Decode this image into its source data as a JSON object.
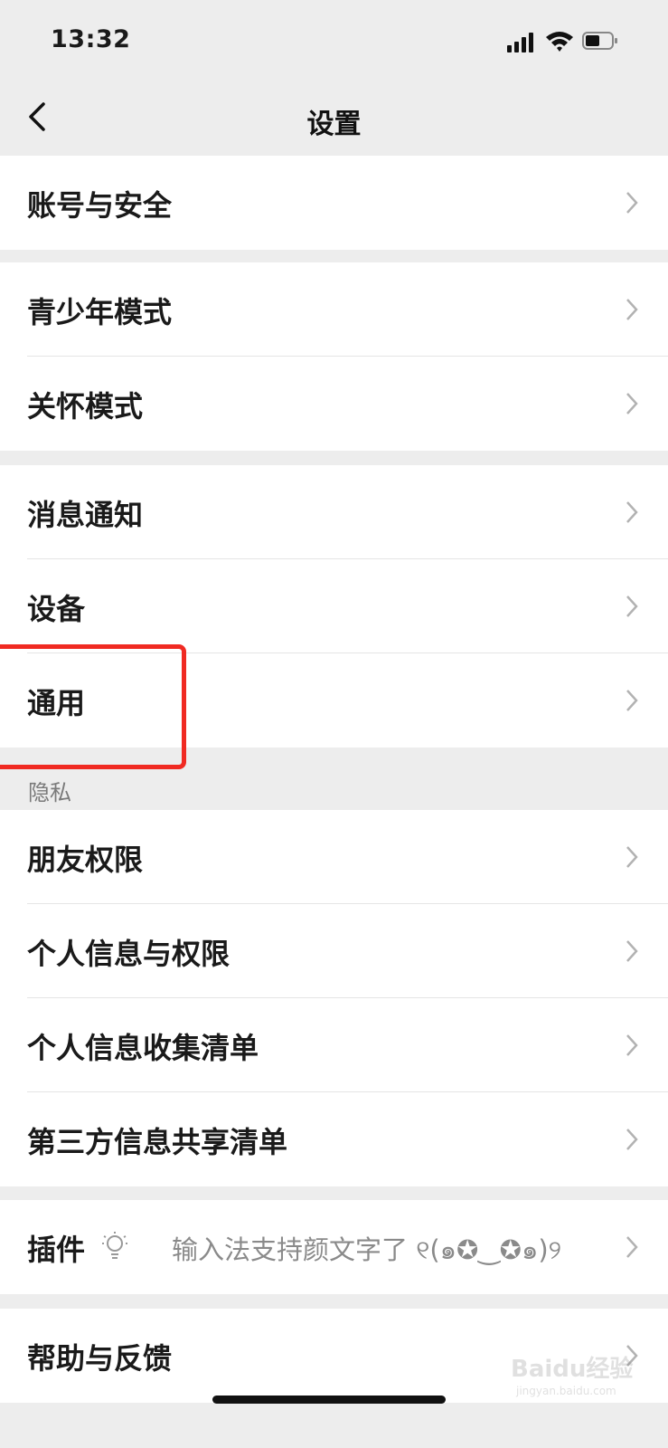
{
  "status": {
    "time": "13:32"
  },
  "nav": {
    "title": "设置"
  },
  "groups": {
    "account": {
      "items": [
        "账号与安全"
      ]
    },
    "mode": {
      "items": [
        "青少年模式",
        "关怀模式"
      ]
    },
    "general": {
      "items": [
        "消息通知",
        "设备",
        "通用"
      ]
    },
    "privacy": {
      "title": "隐私",
      "items": [
        "朋友权限",
        "个人信息与权限",
        "个人信息收集清单",
        "第三方信息共享清单"
      ]
    },
    "plugin": {
      "label": "插件",
      "hint": "输入法支持颜文字了 ୧(๑✪‿✪๑)୨"
    },
    "help": {
      "items": [
        "帮助与反馈"
      ]
    }
  },
  "watermark": {
    "brand": "Baidu经验",
    "url": "jingyan.baidu.com"
  },
  "colors": {
    "background": "#ededed",
    "card": "#ffffff",
    "highlight_box": "#f02a22",
    "secondary_text": "#8a8a8a"
  },
  "icons": [
    "back-arrow-icon",
    "chevron-right-icon",
    "lightbulb-icon",
    "signal-icon",
    "wifi-icon",
    "battery-icon"
  ]
}
